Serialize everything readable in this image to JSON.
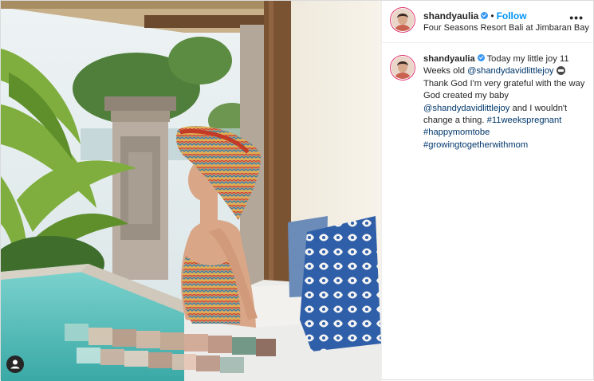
{
  "post": {
    "username": "shandyaulia",
    "follow_label": "Follow",
    "separator": "•",
    "location": "Four Seasons Resort Bali at Jimbaran Bay",
    "more_options": "•••"
  },
  "caption": {
    "username": "shandyaulia",
    "part1": " Today my little joy 11 Weeks old ",
    "mention1": "@shandydavidlittlejoy",
    "part2": " Thank God I'm very grateful with the way God created my baby ",
    "mention2": "@shandydavidlittlejoy",
    "part3": " and I wouldn't change a thing. ",
    "hashtags": [
      "#11weekspregnant",
      "#happymomtobe",
      "#growingtogetherwithmom"
    ]
  },
  "icons": {
    "verified": "verified-badge-icon",
    "emoji": "baby-face-emoji-icon",
    "tag": "user-tag-icon",
    "more": "more-options-icon"
  },
  "colors": {
    "link_blue": "#0095f6",
    "hashtag_navy": "#00376b",
    "text": "#262626",
    "verified": "#3897f0"
  }
}
